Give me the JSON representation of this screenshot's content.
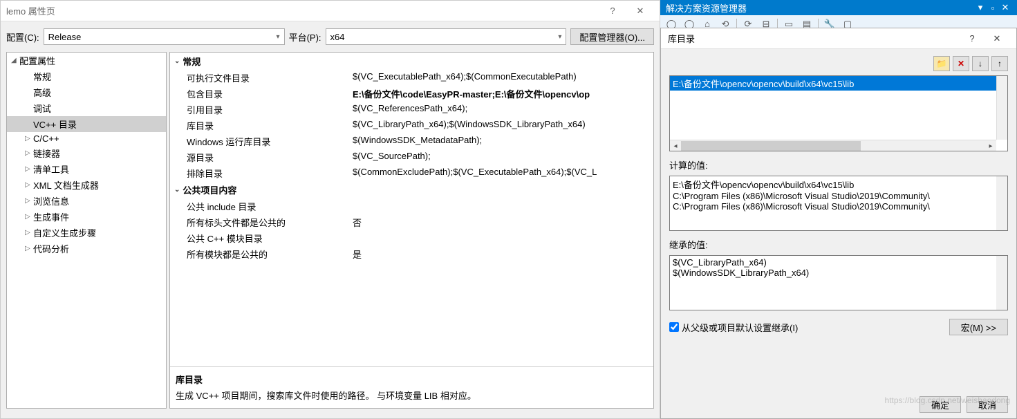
{
  "main": {
    "title": "lemo 属性页",
    "config_label": "配置(C):",
    "config_value": "Release",
    "platform_label": "平台(P):",
    "platform_value": "x64",
    "config_mgr": "配置管理器(O)..."
  },
  "tree": {
    "root": "配置属性",
    "items": [
      {
        "label": "常规",
        "leaf": true
      },
      {
        "label": "高级",
        "leaf": true
      },
      {
        "label": "调试",
        "leaf": true
      },
      {
        "label": "VC++ 目录",
        "leaf": true,
        "selected": true
      },
      {
        "label": "C/C++",
        "leaf": false
      },
      {
        "label": "链接器",
        "leaf": false
      },
      {
        "label": "清单工具",
        "leaf": false
      },
      {
        "label": "XML 文档生成器",
        "leaf": false
      },
      {
        "label": "浏览信息",
        "leaf": false
      },
      {
        "label": "生成事件",
        "leaf": false
      },
      {
        "label": "自定义生成步骤",
        "leaf": false
      },
      {
        "label": "代码分析",
        "leaf": false
      }
    ]
  },
  "props": {
    "group1": "常规",
    "rows1": [
      {
        "name": "可执行文件目录",
        "val": "$(VC_ExecutablePath_x64);$(CommonExecutablePath)"
      },
      {
        "name": "包含目录",
        "val": "E:\\备份文件\\code\\EasyPR-master;E:\\备份文件\\opencv\\op",
        "bold": true
      },
      {
        "name": "引用目录",
        "val": "$(VC_ReferencesPath_x64);"
      },
      {
        "name": "库目录",
        "val": "$(VC_LibraryPath_x64);$(WindowsSDK_LibraryPath_x64)"
      },
      {
        "name": "Windows 运行库目录",
        "val": "$(WindowsSDK_MetadataPath);"
      },
      {
        "name": "源目录",
        "val": "$(VC_SourcePath);"
      },
      {
        "name": "排除目录",
        "val": "$(CommonExcludePath);$(VC_ExecutablePath_x64);$(VC_L"
      }
    ],
    "group2": "公共项目内容",
    "rows2": [
      {
        "name": "公共 include 目录",
        "val": ""
      },
      {
        "name": "所有标头文件都是公共的",
        "val": "否"
      },
      {
        "name": "公共 C++ 模块目录",
        "val": ""
      },
      {
        "name": "所有模块都是公共的",
        "val": "是"
      }
    ],
    "desc_title": "库目录",
    "desc_text": "生成 VC++ 项目期间，搜索库文件时使用的路径。  与环境变量 LIB 相对应。"
  },
  "sln": {
    "title": "解决方案资源管理器"
  },
  "lib": {
    "title": "库目录",
    "entries": [
      "E:\\备份文件\\opencv\\opencv\\build\\x64\\vc15\\lib"
    ],
    "calc_label": "计算的值:",
    "calc_values": [
      "E:\\备份文件\\opencv\\opencv\\build\\x64\\vc15\\lib",
      "C:\\Program Files (x86)\\Microsoft Visual Studio\\2019\\Community\\",
      "C:\\Program Files (x86)\\Microsoft Visual Studio\\2019\\Community\\"
    ],
    "inherit_label": "继承的值:",
    "inherit_values": [
      "$(VC_LibraryPath_x64)",
      "$(WindowsSDK_LibraryPath_x64)"
    ],
    "inherit_chk": "从父级或项目默认设置继承(I)",
    "macro_btn": "宏(M) >>",
    "ok": "确定",
    "cancel": "取消"
  },
  "watermark": "https://blog.csdn.net/weishaodong"
}
